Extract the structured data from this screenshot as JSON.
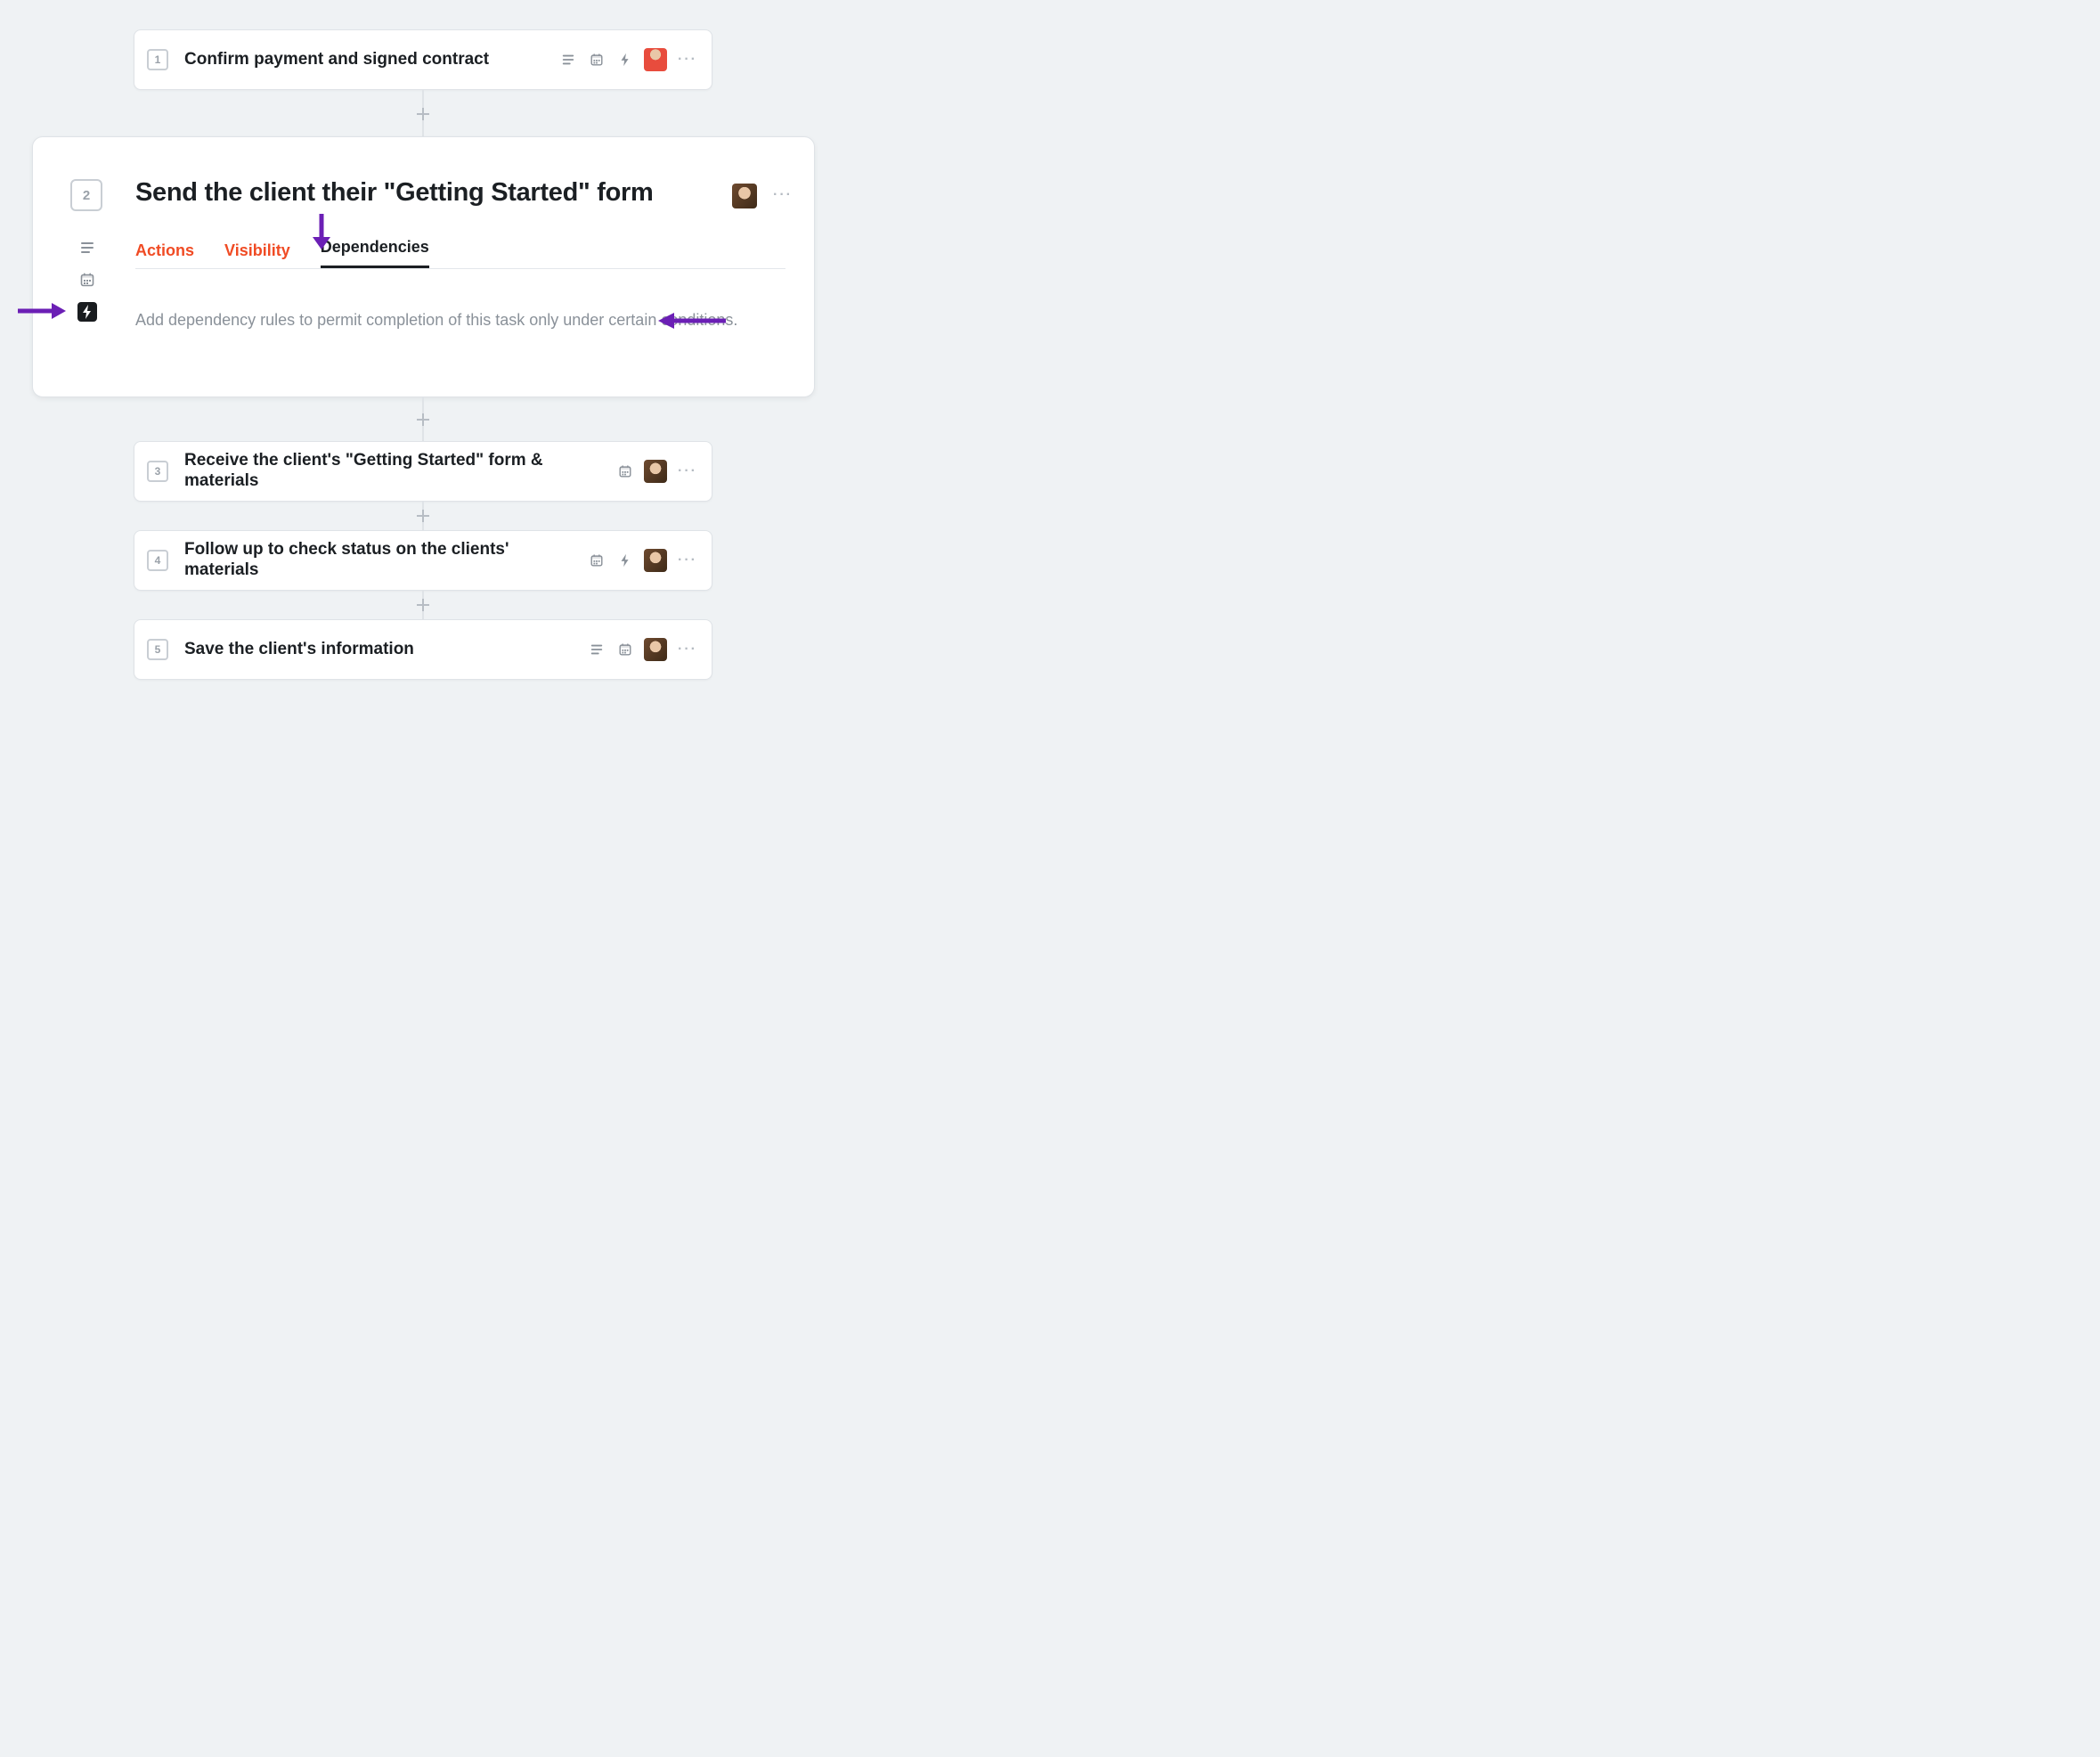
{
  "tasks": [
    {
      "num": "1",
      "title": "Confirm payment and signed contract"
    },
    {
      "num": "2",
      "title": "Send the client their \"Getting Started\" form"
    },
    {
      "num": "3",
      "title": "Receive the client's \"Getting Started\" form & materials"
    },
    {
      "num": "4",
      "title": "Follow up to check status on the clients' materials"
    },
    {
      "num": "5",
      "title": "Save the client's information"
    }
  ],
  "expanded": {
    "tabs": {
      "actions": "Actions",
      "visibility": "Visibility",
      "dependencies": "Dependencies"
    },
    "description": "Add dependency rules to permit completion of this task only under certain conditions."
  },
  "icons": {
    "description": "description-icon",
    "calendar": "calendar-icon",
    "bolt": "bolt-icon",
    "more": "…"
  }
}
